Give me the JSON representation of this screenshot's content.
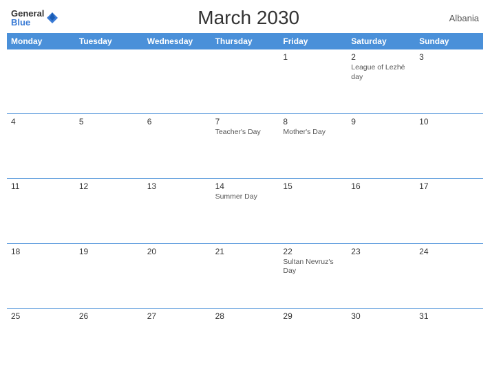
{
  "header": {
    "logo_general": "General",
    "logo_blue": "Blue",
    "title": "March 2030",
    "country": "Albania"
  },
  "calendar": {
    "days_of_week": [
      "Monday",
      "Tuesday",
      "Wednesday",
      "Thursday",
      "Friday",
      "Saturday",
      "Sunday"
    ],
    "weeks": [
      [
        {
          "day": "",
          "event": ""
        },
        {
          "day": "",
          "event": ""
        },
        {
          "day": "",
          "event": ""
        },
        {
          "day": "",
          "event": ""
        },
        {
          "day": "1",
          "event": ""
        },
        {
          "day": "2",
          "event": "League of Lezhë day"
        },
        {
          "day": "3",
          "event": ""
        }
      ],
      [
        {
          "day": "4",
          "event": ""
        },
        {
          "day": "5",
          "event": ""
        },
        {
          "day": "6",
          "event": ""
        },
        {
          "day": "7",
          "event": "Teacher's Day"
        },
        {
          "day": "8",
          "event": "Mother's Day"
        },
        {
          "day": "9",
          "event": ""
        },
        {
          "day": "10",
          "event": ""
        }
      ],
      [
        {
          "day": "11",
          "event": ""
        },
        {
          "day": "12",
          "event": ""
        },
        {
          "day": "13",
          "event": ""
        },
        {
          "day": "14",
          "event": "Summer Day"
        },
        {
          "day": "15",
          "event": ""
        },
        {
          "day": "16",
          "event": ""
        },
        {
          "day": "17",
          "event": ""
        }
      ],
      [
        {
          "day": "18",
          "event": ""
        },
        {
          "day": "19",
          "event": ""
        },
        {
          "day": "20",
          "event": ""
        },
        {
          "day": "21",
          "event": ""
        },
        {
          "day": "22",
          "event": "Sultan Nevruz's Day"
        },
        {
          "day": "23",
          "event": ""
        },
        {
          "day": "24",
          "event": ""
        }
      ],
      [
        {
          "day": "25",
          "event": ""
        },
        {
          "day": "26",
          "event": ""
        },
        {
          "day": "27",
          "event": ""
        },
        {
          "day": "28",
          "event": ""
        },
        {
          "day": "29",
          "event": ""
        },
        {
          "day": "30",
          "event": ""
        },
        {
          "day": "31",
          "event": ""
        }
      ]
    ]
  }
}
